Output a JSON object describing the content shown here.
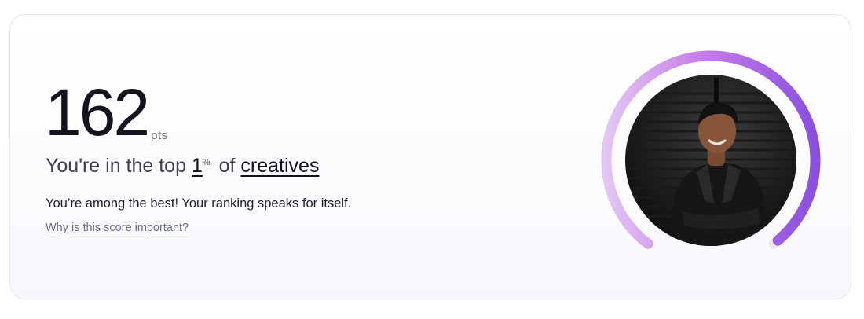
{
  "score": {
    "value": "162",
    "unit": "pts"
  },
  "rank": {
    "prefix": "You're in the top",
    "percent": "1",
    "percent_sign": "%",
    "middle": "of",
    "group": "creatives"
  },
  "subtitle": "You’re among the best! Your ranking speaks for itself.",
  "help_link": "Why is this score important?",
  "gauge": {
    "progress_fraction": 0.99,
    "colors": {
      "start": "#e2c6f4",
      "mid": "#c77ee8",
      "end": "#8a4fe0",
      "track": "#e9e9ee"
    },
    "avatar": "avatar-photo-person-in-leather-jacket"
  }
}
